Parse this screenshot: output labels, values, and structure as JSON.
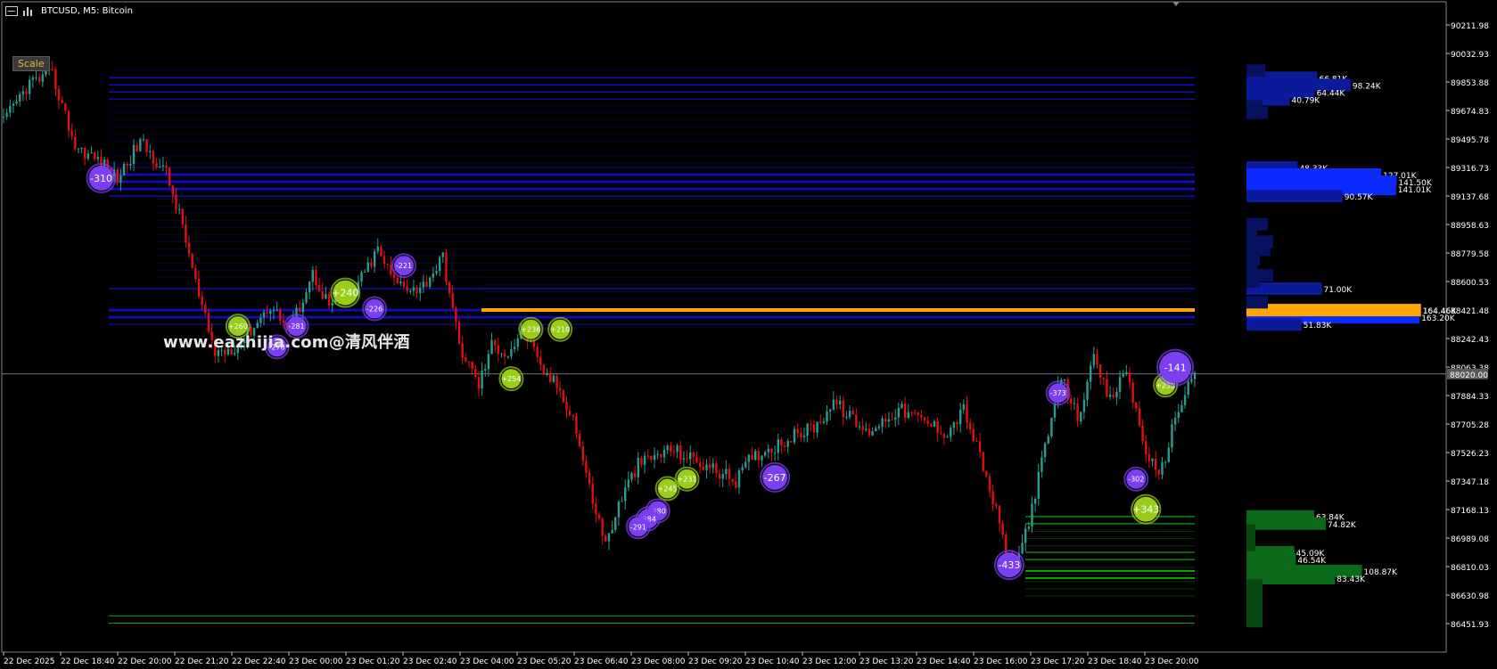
{
  "window": {
    "title": "BTCUSD, M5:  Bitcoin",
    "scale_label": "Scale",
    "watermark": "www.eazhijia.com@清风伴酒"
  },
  "colors": {
    "background": "#000000",
    "bull": "#2a9d8f",
    "bear": "#e01010",
    "sell_bubble": "#7b3ff0",
    "buy_bubble": "#9acd1a",
    "orange_level": "#ffa500",
    "blue_level": "#1010d0",
    "green_level": "#10a010",
    "current_price_bg": "#5a5a5a"
  },
  "chart_data": {
    "type": "candlestick",
    "symbol": "BTCUSD",
    "timeframe": "M5",
    "y_ticks": [
      "90211.98",
      "90032.93",
      "89853.88",
      "89674.83",
      "89495.78",
      "89316.73",
      "89137.68",
      "88958.63",
      "88779.58",
      "88600.53",
      "88421.48",
      "88242.43",
      "88063.38",
      "87884.33",
      "87705.28",
      "87526.23",
      "87347.18",
      "87168.13",
      "86989.08",
      "86810.03",
      "86630.98",
      "86451.93"
    ],
    "y_tick_values": [
      90211.98,
      90032.93,
      89853.88,
      89674.83,
      89495.78,
      89316.73,
      89137.68,
      88958.63,
      88779.58,
      88600.53,
      88421.48,
      88242.43,
      88063.38,
      87884.33,
      87705.28,
      87526.23,
      87347.18,
      87168.13,
      86989.08,
      86810.03,
      86630.98,
      86451.93
    ],
    "x_ticks": [
      "22 Dec 2025",
      "22 Dec 18:40",
      "22 Dec 20:00",
      "22 Dec 21:20",
      "22 Dec 22:40",
      "23 Dec 00:00",
      "23 Dec 01:20",
      "23 Dec 02:40",
      "23 Dec 04:00",
      "23 Dec 05:20",
      "23 Dec 06:40",
      "23 Dec 08:00",
      "23 Dec 09:20",
      "23 Dec 10:40",
      "23 Dec 12:00",
      "23 Dec 13:20",
      "23 Dec 14:40",
      "23 Dec 16:00",
      "23 Dec 17:20",
      "23 Dec 18:40",
      "23 Dec 20:00"
    ],
    "current_price": "88020.00",
    "current_price_value": 88020.0,
    "close_path": [
      [
        0,
        89600
      ],
      [
        8,
        89850
      ],
      [
        15,
        89900
      ],
      [
        22,
        89450
      ],
      [
        30,
        89350
      ],
      [
        35,
        89250
      ],
      [
        42,
        89480
      ],
      [
        50,
        89280
      ],
      [
        55,
        88950
      ],
      [
        60,
        88500
      ],
      [
        65,
        88150
      ],
      [
        72,
        88200
      ],
      [
        78,
        88350
      ],
      [
        82,
        88450
      ],
      [
        88,
        88300
      ],
      [
        95,
        88650
      ],
      [
        100,
        88450
      ],
      [
        108,
        88550
      ],
      [
        115,
        88800
      ],
      [
        120,
        88600
      ],
      [
        128,
        88550
      ],
      [
        135,
        88750
      ],
      [
        140,
        88200
      ],
      [
        146,
        87950
      ],
      [
        150,
        88200
      ],
      [
        155,
        88150
      ],
      [
        160,
        88300
      ],
      [
        165,
        88050
      ],
      [
        170,
        87950
      ],
      [
        175,
        87750
      ],
      [
        180,
        87300
      ],
      [
        185,
        86950
      ],
      [
        190,
        87250
      ],
      [
        195,
        87450
      ],
      [
        205,
        87550
      ],
      [
        215,
        87450
      ],
      [
        225,
        87350
      ],
      [
        230,
        87500
      ],
      [
        240,
        87600
      ],
      [
        250,
        87700
      ],
      [
        255,
        87850
      ],
      [
        265,
        87650
      ],
      [
        275,
        87800
      ],
      [
        285,
        87700
      ],
      [
        290,
        87650
      ],
      [
        295,
        87800
      ],
      [
        300,
        87500
      ],
      [
        305,
        87150
      ],
      [
        310,
        86750
      ],
      [
        315,
        87100
      ],
      [
        320,
        87550
      ],
      [
        325,
        88000
      ],
      [
        330,
        87750
      ],
      [
        335,
        88100
      ],
      [
        340,
        87850
      ],
      [
        345,
        88050
      ],
      [
        350,
        87600
      ],
      [
        355,
        87350
      ],
      [
        360,
        87750
      ],
      [
        366,
        88050
      ]
    ],
    "trade_bubbles": [
      {
        "label": "-310",
        "side": "sell",
        "bar": 10,
        "price": 89250
      },
      {
        "label": "+260",
        "side": "buy",
        "bar": 24,
        "price": 88320
      },
      {
        "label": "-281",
        "side": "sell",
        "bar": 30,
        "price": 88320
      },
      {
        "label": "-278",
        "side": "sell",
        "bar": 28,
        "price": 88190
      },
      {
        "label": "+240",
        "side": "buy",
        "bar": 35,
        "price": 88530
      },
      {
        "label": "-226",
        "side": "sell",
        "bar": 38,
        "price": 88430
      },
      {
        "label": "-221",
        "side": "sell",
        "bar": 41,
        "price": 88700
      },
      {
        "label": "+236",
        "side": "buy",
        "bar": 54,
        "price": 88300
      },
      {
        "label": "+210",
        "side": "buy",
        "bar": 57,
        "price": 88300
      },
      {
        "label": "+254",
        "side": "buy",
        "bar": 52,
        "price": 87990
      },
      {
        "label": "+231",
        "side": "buy",
        "bar": 70,
        "price": 87360
      },
      {
        "label": "+245",
        "side": "buy",
        "bar": 68,
        "price": 87300
      },
      {
        "label": "-280",
        "side": "sell",
        "bar": 67,
        "price": 87160
      },
      {
        "label": "-284",
        "side": "sell",
        "bar": 66,
        "price": 87110
      },
      {
        "label": "-291",
        "side": "sell",
        "bar": 65,
        "price": 87060
      },
      {
        "label": "-267",
        "side": "sell",
        "bar": 79,
        "price": 87370
      },
      {
        "label": "-433",
        "side": "sell",
        "bar": 103,
        "price": 86820
      },
      {
        "label": "-373",
        "side": "sell",
        "bar": 108,
        "price": 87900
      },
      {
        "label": "-302",
        "side": "sell",
        "bar": 116,
        "price": 87360
      },
      {
        "label": "+343",
        "side": "buy",
        "bar": 117,
        "price": 87170
      },
      {
        "label": "+255",
        "side": "buy",
        "bar": 119,
        "price": 87950
      },
      {
        "label": "-141",
        "side": "sell",
        "bar": 120,
        "price": 88060
      }
    ],
    "orange_level": 88421.48,
    "profile_sell": [
      {
        "price": 89880,
        "label": "66.81K",
        "value": 66.81
      },
      {
        "price": 89835,
        "label": "98.24K",
        "value": 98.24
      },
      {
        "price": 89790,
        "label": "64.44K",
        "value": 64.44
      },
      {
        "price": 89745,
        "label": "40.79K",
        "value": 40.79
      },
      {
        "price": 89317,
        "label": "48.33K",
        "value": 48.33
      },
      {
        "price": 89272,
        "label": "127.01K",
        "value": 127.01
      },
      {
        "price": 89227,
        "label": "141.50K",
        "value": 141.5
      },
      {
        "price": 89182,
        "label": "141.01K",
        "value": 141.01
      },
      {
        "price": 89137,
        "label": "90.57K",
        "value": 90.57
      },
      {
        "price": 88556,
        "label": "71.00K",
        "value": 71.0
      },
      {
        "price": 88421,
        "label": "164.46K",
        "value": 164.46
      },
      {
        "price": 88376,
        "label": "163.20K",
        "value": 163.2
      },
      {
        "price": 88331,
        "label": "51.83K",
        "value": 51.83
      }
    ],
    "profile_buy": [
      {
        "price": 87125,
        "label": "63.84K",
        "value": 63.84
      },
      {
        "price": 87080,
        "label": "74.82K",
        "value": 74.82
      },
      {
        "price": 86900,
        "label": "45.09K",
        "value": 45.09
      },
      {
        "price": 86855,
        "label": "46.54K",
        "value": 46.54
      },
      {
        "price": 86782,
        "label": "108.87K",
        "value": 108.87
      },
      {
        "price": 86737,
        "label": "83.43K",
        "value": 83.43
      }
    ]
  }
}
